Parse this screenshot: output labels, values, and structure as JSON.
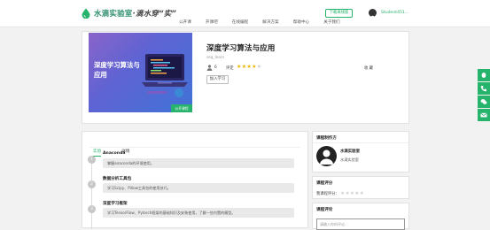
{
  "header": {
    "logo_name": "水滴实验室",
    "logo_slogan": "·滴水穿“实”",
    "nav": [
      "公开课",
      "开课吧",
      "在线编程",
      "解决方案",
      "帮助中心",
      "关于我们"
    ],
    "download_label": "下载离线版",
    "username": "Student451..."
  },
  "course": {
    "cover_title": "深度学习算法与应用",
    "cover_badge": "公开课程",
    "title": "深度学习算法与应用",
    "subtitle": "seq_learn",
    "learners": "6",
    "rating_label": "评定",
    "rating_stars": 4,
    "collect_label": "收 藏",
    "join_label": "加入学习"
  },
  "content": {
    "tabs": [
      "实验",
      "详情"
    ],
    "chapters": [
      {
        "num": "1",
        "title": "Anaconda",
        "desc": "掌握anaconda的环境使用。"
      },
      {
        "num": "2",
        "title": "数据分析工具包",
        "desc": "学习Scipy、Pillow工具包的使用技巧。"
      },
      {
        "num": "3",
        "title": "深度学习框架",
        "desc": "学习TensorFlow、Pytorch框架的基础知识及安装使用，了解一些内置的模型。"
      }
    ]
  },
  "sidebar": {
    "author_box_title": "课程制作方",
    "author_name": "水滴实验室",
    "author_org": "水滴实验室",
    "rating_box_title": "课程评分",
    "rating_line_label": "我课程评分：",
    "comment_box_title": "课程评论",
    "comment_placeholder": "请输入你的评论..."
  },
  "colors": {
    "accent": "#26b36b",
    "star": "#f0b400"
  }
}
